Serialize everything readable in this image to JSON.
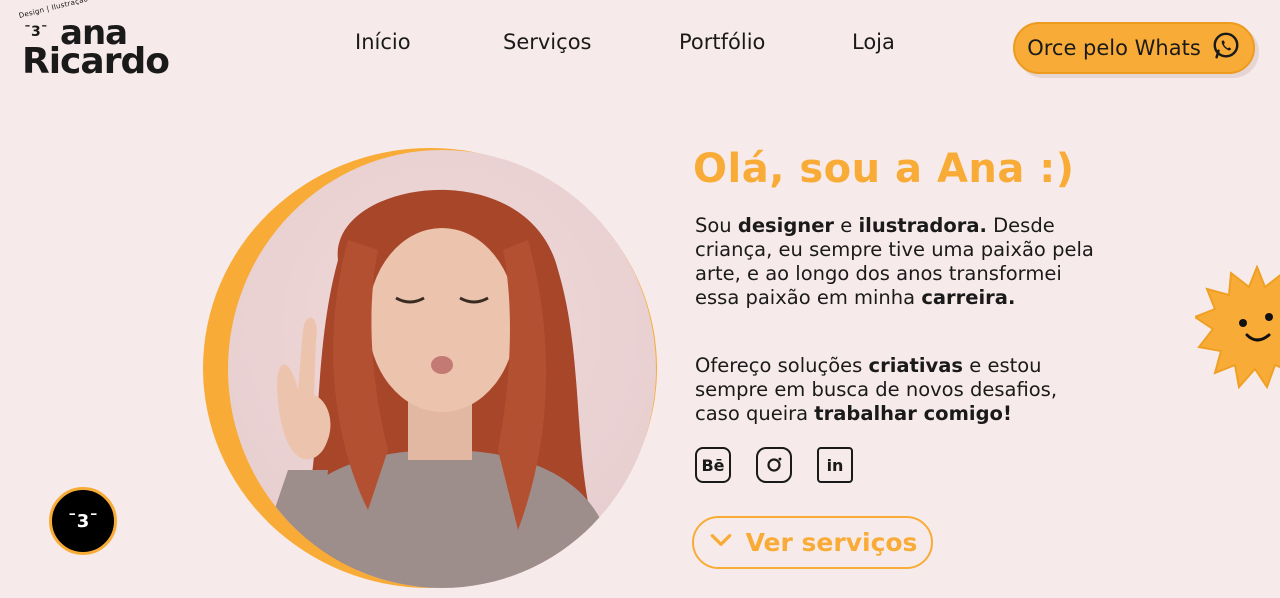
{
  "logo": {
    "tagline": "Design | Ilustração",
    "face": "ˉ3ˉ",
    "line1": "ana",
    "line2": "Ricardo"
  },
  "nav": {
    "items": [
      {
        "label": "Início"
      },
      {
        "label": "Serviços"
      },
      {
        "label": "Portfólio"
      },
      {
        "label": "Loja"
      }
    ]
  },
  "whats_button": {
    "label": "Orce pelo Whats",
    "icon": "whatsapp-icon"
  },
  "hero": {
    "title": "Olá, sou a Ana :)",
    "para1": {
      "t1": "Sou ",
      "b1": "designer",
      "t2": " e ",
      "b2": "ilustradora.",
      "t3": " Desde criança, eu sempre tive uma paixão pela arte, e ao longo dos anos transformei essa paixão em minha ",
      "b3": "carreira."
    },
    "para2": {
      "t1": "Ofereço soluções ",
      "b1": "criativas",
      "t2": " e estou sempre em busca de novos desafios, caso queira ",
      "b2": "trabalhar comigo!"
    },
    "socials": [
      {
        "icon": "behance-icon",
        "glyph": "Bē"
      },
      {
        "icon": "instagram-icon",
        "glyph": ""
      },
      {
        "icon": "linkedin-icon",
        "glyph": "in"
      }
    ],
    "services_button": {
      "label": "Ver serviços",
      "icon": "chevron-down-icon"
    }
  },
  "floating_face": {
    "glyph": "ˉ3ˉ"
  },
  "colors": {
    "background": "#f7eaea",
    "accent": "#f8ac37",
    "text": "#1a1a1a"
  }
}
